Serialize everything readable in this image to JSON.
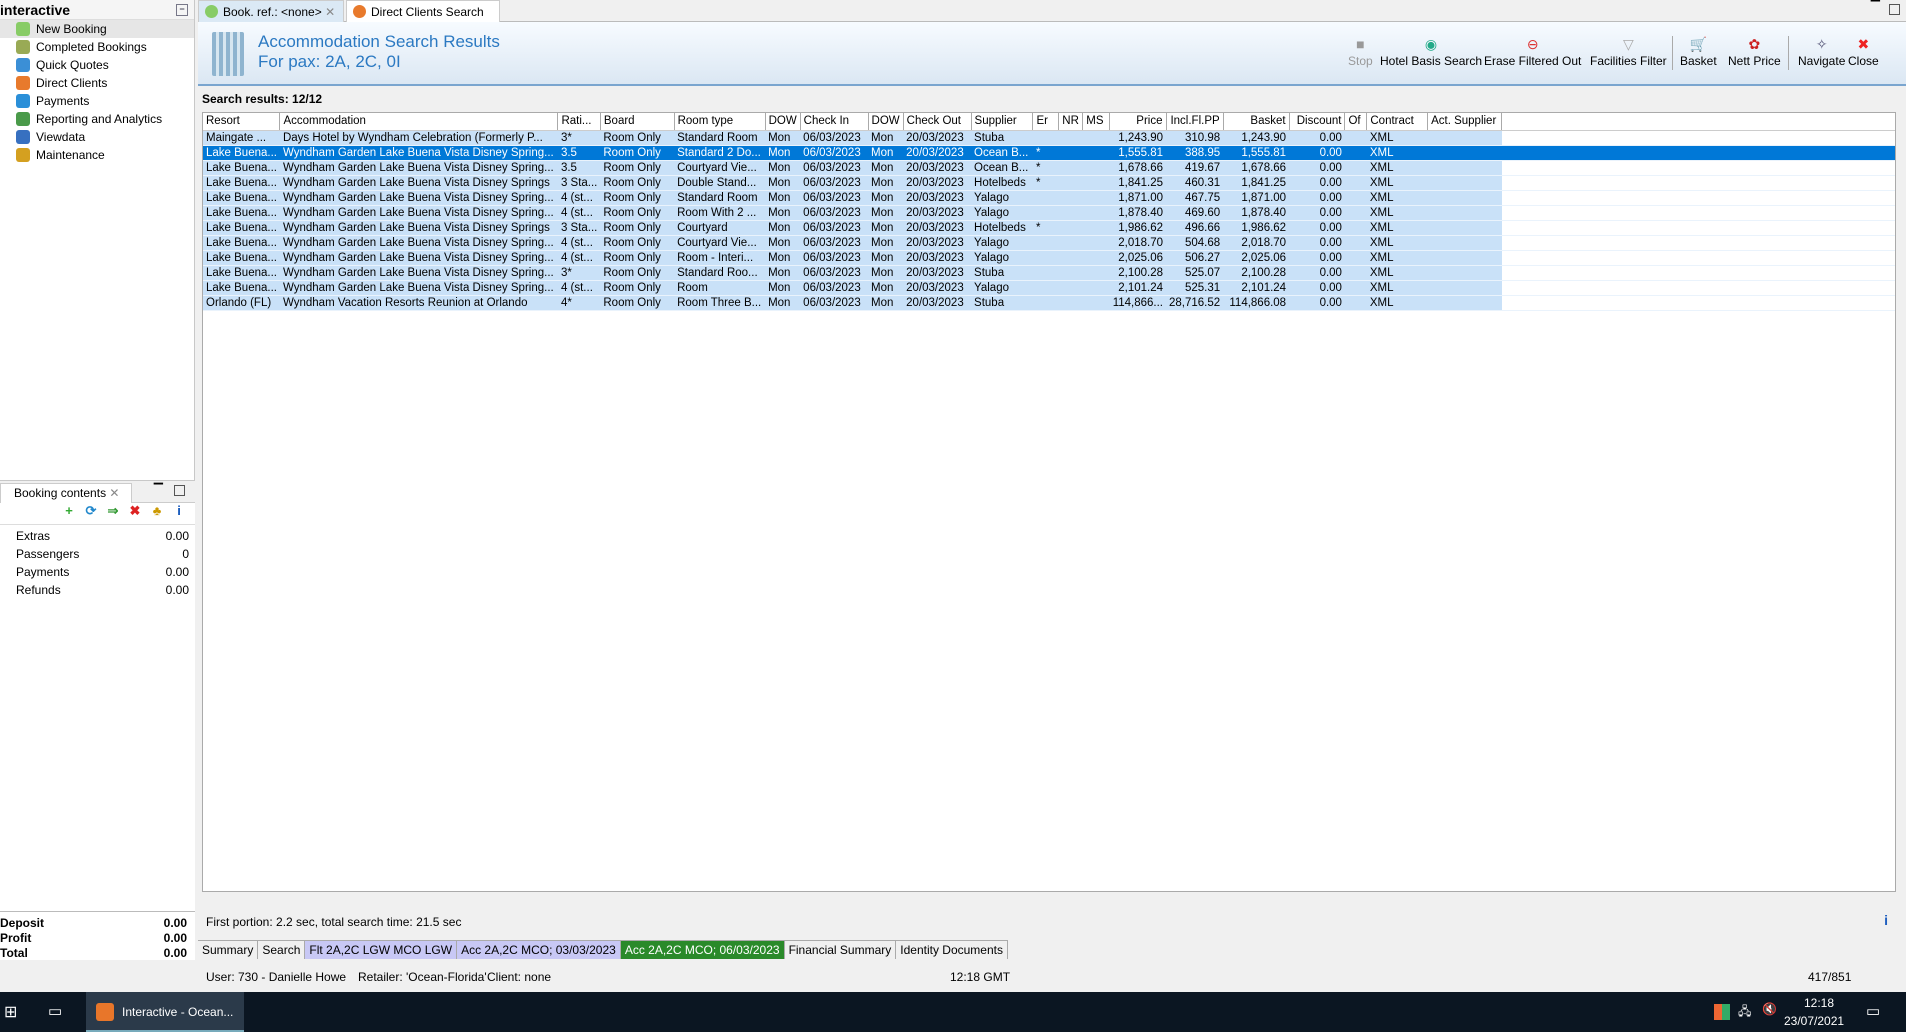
{
  "left_panel": {
    "title": "interactive",
    "nav": [
      "New Booking",
      "Completed Bookings",
      "Quick Quotes",
      "Direct Clients",
      "Payments",
      "Reporting and Analytics",
      "Viewdata",
      "Maintenance"
    ]
  },
  "booking_contents": {
    "tab": "Booking contents",
    "rows": [
      {
        "label": "Extras",
        "value": "0.00"
      },
      {
        "label": "Passengers",
        "value": "0"
      },
      {
        "label": "Payments",
        "value": "0.00"
      },
      {
        "label": "Refunds",
        "value": "0.00"
      }
    ],
    "totals": [
      {
        "label": "Deposit",
        "value": "0.00"
      },
      {
        "label": "Profit",
        "value": "0.00"
      },
      {
        "label": "Total",
        "value": "0.00"
      }
    ]
  },
  "tabs": [
    "Book. ref.: <none>",
    "Direct Clients Search"
  ],
  "header": {
    "title": "Accommodation Search Results",
    "subtitle": "For pax: 2A, 2C, 0I"
  },
  "toolbar": [
    "Stop",
    "Hotel Basis Search",
    "Erase Filtered Out",
    "Facilities Filter",
    "Basket",
    "Nett Price",
    "Navigate",
    "Close"
  ],
  "search_results": "Search results: 12/12",
  "columns": [
    "Resort",
    "Accommodation",
    "Rati...",
    "Board",
    "Room type",
    "DOW",
    "Check In",
    "DOW",
    "Check Out",
    "Supplier",
    "Er",
    "NR",
    "MS",
    "Price",
    "Incl.Fl.PP",
    "Basket",
    "Discount",
    "Of",
    "Contract",
    "Act. Supplier"
  ],
  "rows": [
    [
      "Maingate ...",
      "Days Hotel by Wyndham Celebration (Formerly P...",
      "3*",
      "Room Only",
      "Standard Room",
      "Mon",
      "06/03/2023",
      "Mon",
      "20/03/2023",
      "Stuba",
      "",
      "",
      "",
      "1,243.90",
      "310.98",
      "1,243.90",
      "0.00",
      "",
      "XML",
      ""
    ],
    [
      "Lake Buena...",
      "Wyndham Garden Lake Buena Vista Disney Spring...",
      "3.5",
      "Room Only",
      "Standard 2 Do...",
      "Mon",
      "06/03/2023",
      "Mon",
      "20/03/2023",
      "Ocean B...",
      "*",
      "",
      "",
      "1,555.81",
      "388.95",
      "1,555.81",
      "0.00",
      "",
      "XML",
      ""
    ],
    [
      "Lake Buena...",
      "Wyndham Garden Lake Buena Vista Disney Spring...",
      "3.5",
      "Room Only",
      "Courtyard Vie...",
      "Mon",
      "06/03/2023",
      "Mon",
      "20/03/2023",
      "Ocean B...",
      "*",
      "",
      "",
      "1,678.66",
      "419.67",
      "1,678.66",
      "0.00",
      "",
      "XML",
      ""
    ],
    [
      "Lake Buena...",
      "Wyndham Garden Lake Buena Vista Disney Springs",
      "3 Sta...",
      "Room Only",
      "Double Stand...",
      "Mon",
      "06/03/2023",
      "Mon",
      "20/03/2023",
      "Hotelbeds",
      "*",
      "",
      "",
      "1,841.25",
      "460.31",
      "1,841.25",
      "0.00",
      "",
      "XML",
      ""
    ],
    [
      "Lake Buena...",
      "Wyndham Garden Lake Buena Vista Disney Spring...",
      "4 (st...",
      "Room Only",
      "Standard Room",
      "Mon",
      "06/03/2023",
      "Mon",
      "20/03/2023",
      "Yalago",
      "",
      "",
      "",
      "1,871.00",
      "467.75",
      "1,871.00",
      "0.00",
      "",
      "XML",
      ""
    ],
    [
      "Lake Buena...",
      "Wyndham Garden Lake Buena Vista Disney Spring...",
      "4 (st...",
      "Room Only",
      "Room With 2 ...",
      "Mon",
      "06/03/2023",
      "Mon",
      "20/03/2023",
      "Yalago",
      "",
      "",
      "",
      "1,878.40",
      "469.60",
      "1,878.40",
      "0.00",
      "",
      "XML",
      ""
    ],
    [
      "Lake Buena...",
      "Wyndham Garden Lake Buena Vista Disney Springs",
      "3 Sta...",
      "Room Only",
      "Courtyard",
      "Mon",
      "06/03/2023",
      "Mon",
      "20/03/2023",
      "Hotelbeds",
      "*",
      "",
      "",
      "1,986.62",
      "496.66",
      "1,986.62",
      "0.00",
      "",
      "XML",
      ""
    ],
    [
      "Lake Buena...",
      "Wyndham Garden Lake Buena Vista Disney Spring...",
      "4 (st...",
      "Room Only",
      "Courtyard Vie...",
      "Mon",
      "06/03/2023",
      "Mon",
      "20/03/2023",
      "Yalago",
      "",
      "",
      "",
      "2,018.70",
      "504.68",
      "2,018.70",
      "0.00",
      "",
      "XML",
      ""
    ],
    [
      "Lake Buena...",
      "Wyndham Garden Lake Buena Vista Disney Spring...",
      "4 (st...",
      "Room Only",
      "Room - Interi...",
      "Mon",
      "06/03/2023",
      "Mon",
      "20/03/2023",
      "Yalago",
      "",
      "",
      "",
      "2,025.06",
      "506.27",
      "2,025.06",
      "0.00",
      "",
      "XML",
      ""
    ],
    [
      "Lake Buena...",
      "Wyndham Garden Lake Buena Vista Disney Spring...",
      "3*",
      "Room Only",
      "Standard Roo...",
      "Mon",
      "06/03/2023",
      "Mon",
      "20/03/2023",
      "Stuba",
      "",
      "",
      "",
      "2,100.28",
      "525.07",
      "2,100.28",
      "0.00",
      "",
      "XML",
      ""
    ],
    [
      "Lake Buena...",
      "Wyndham Garden Lake Buena Vista Disney Spring...",
      "4 (st...",
      "Room Only",
      "Room",
      "Mon",
      "06/03/2023",
      "Mon",
      "20/03/2023",
      "Yalago",
      "",
      "",
      "",
      "2,101.24",
      "525.31",
      "2,101.24",
      "0.00",
      "",
      "XML",
      ""
    ],
    [
      "Orlando (FL)",
      "Wyndham Vacation Resorts Reunion at Orlando",
      "4*",
      "Room Only",
      "Room Three B...",
      "Mon",
      "06/03/2023",
      "Mon",
      "20/03/2023",
      "Stuba",
      "",
      "",
      "",
      "114,866...",
      "28,716.52",
      "114,866.08",
      "0.00",
      "",
      "XML",
      ""
    ]
  ],
  "selected_row": 1,
  "status": "First portion: 2.2 sec, total search time: 21.5 sec",
  "bottom_tabs": [
    "Summary",
    "Search",
    "Flt 2A,2C LGW MCO LGW",
    "Acc 2A,2C MCO; 03/03/2023",
    "Acc 2A,2C MCO; 06/03/2023",
    "Financial Summary",
    "Identity Documents"
  ],
  "status_bar": {
    "user": "User: 730 - Danielle Howe",
    "retailer": "Retailer: 'Ocean-Florida'",
    "client": "Client: none",
    "time": "12:18 GMT",
    "memory": "417/851"
  },
  "taskbar": {
    "app": "Interactive - Ocean...",
    "time": "12:18",
    "date": "23/07/2021"
  }
}
